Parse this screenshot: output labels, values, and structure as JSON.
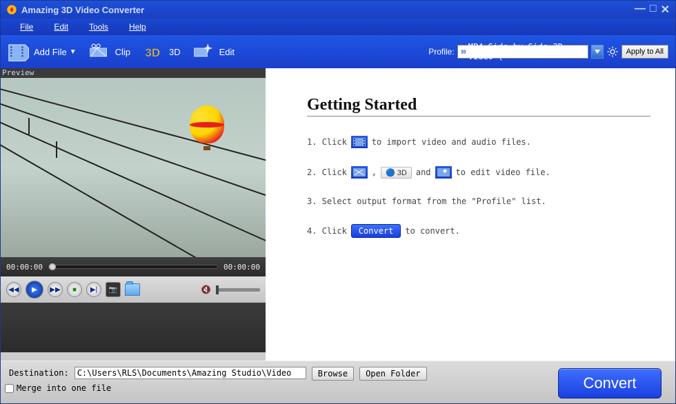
{
  "title": "Amazing 3D Video Converter",
  "menu": {
    "file": "File",
    "edit": "Edit",
    "tools": "Tools",
    "help": "Help"
  },
  "toolbar": {
    "addFile": "Add File",
    "clip": "Clip",
    "threeD": "3D",
    "edit": "Edit"
  },
  "profile": {
    "label": "Profile:",
    "value": "MP4 Side by Side 3D Video (",
    "applyAll": "Apply to All"
  },
  "preview": {
    "label": "Preview",
    "timeStart": "00:00:00",
    "timeEnd": "00:00:00"
  },
  "gettingStarted": {
    "title": "Getting Started",
    "step1a": "1. Click",
    "step1b": "to import video and audio files.",
    "step2a": "2. Click",
    "step2b": ",",
    "step2c": "and",
    "step2d": "to edit video file.",
    "step3": "3. Select output format from the \"Profile\" list.",
    "step4a": "4. Click",
    "step4b": "Convert",
    "step4c": "to convert.",
    "threeDLabel": "3D"
  },
  "bottom": {
    "destLabel": "Destination:",
    "destPath": "C:\\Users\\RLS\\Documents\\Amazing Studio\\Video",
    "browse": "Browse",
    "openFolder": "Open Folder",
    "merge": "Merge into one file",
    "convert": "Convert"
  }
}
